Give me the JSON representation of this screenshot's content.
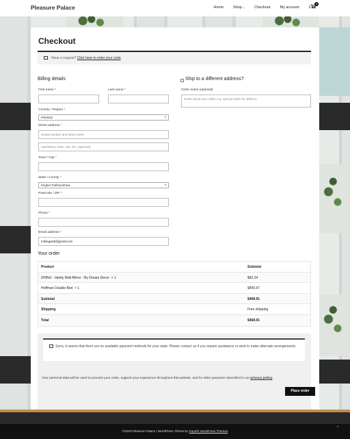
{
  "header": {
    "site_title": "Pleasure Palace",
    "nav": [
      "Home",
      "Shop",
      "Checkout",
      "My account",
      "Cart"
    ],
    "shop_chevron": "⌄",
    "cart_count": "0"
  },
  "page": {
    "title": "Checkout"
  },
  "coupon": {
    "text": "Have a coupon?",
    "link": "Click here to enter your code"
  },
  "billing": {
    "heading": "Billing details",
    "first_name_label": "First name",
    "last_name_label": "Last name",
    "country_label": "Country / Region",
    "country_value": "Pakistan",
    "street_label": "Street address",
    "street_placeholder": "House number and street name",
    "apartment_placeholder": "Apartment, suite, unit, etc. (optional)",
    "town_label": "Town / City",
    "state_label": "State / County",
    "state_value": "Khyber Pakhtunkhwa",
    "postcode_label": "Postcode / ZIP",
    "phone_label": "Phone",
    "email_label": "Email address",
    "email_value": "mikingweb@gmail.com",
    "required_mark": "*"
  },
  "shipping": {
    "ship_diff_label": "Ship to a different address?",
    "notes_label": "Order notes (optional)",
    "notes_placeholder": "Notes about your order, e.g. special notes for delivery."
  },
  "order": {
    "heading": "Your order",
    "col_product": "Product",
    "col_subtotal": "Subtotal",
    "items": [
      {
        "name": "ZHINU - Vanity Wall Mirror - By Dream Decor",
        "qty": "× 1",
        "price": "$62.24"
      },
      {
        "name": "Hoffman Double Bed",
        "qty": "× 1",
        "price": "$406.67"
      }
    ],
    "subtotal_label": "Subtotal",
    "subtotal_value": "$468.91",
    "shipping_label": "Shipping",
    "shipping_value": "Free shipping",
    "total_label": "Total",
    "total_value": "$468.91"
  },
  "payment": {
    "notice": "Sorry, it seems that there are no available payment methods for your state. Please contact us if you require assistance or wish to make alternate arrangements.",
    "privacy_text": "Your personal data will be used to process your order, support your experience throughout this website, and for other purposes described in our",
    "privacy_link": "privacy policy",
    "privacy_end": ".",
    "place_order": "Place order"
  },
  "footer": {
    "text": "©2023 Pleasure Palace | WordPress Theme by",
    "link": "Superb WordPress Themes",
    "scroll_top": "^"
  }
}
